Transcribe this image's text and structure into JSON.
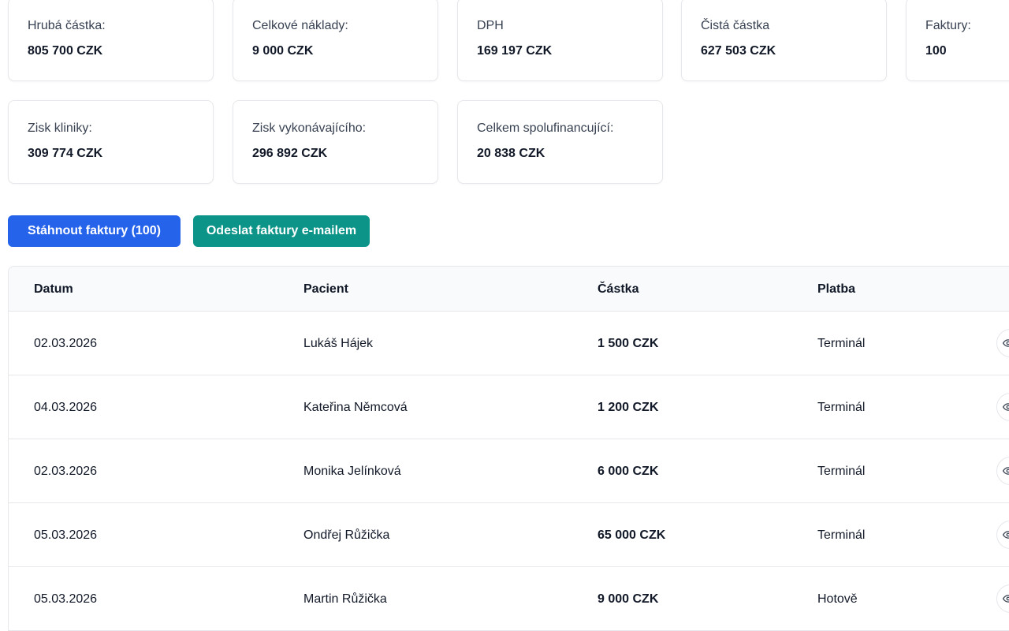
{
  "summary": {
    "row1": [
      {
        "label": "Hrubá částka:",
        "value": "805 700 CZK"
      },
      {
        "label": "Celkové náklady:",
        "value": "9 000 CZK"
      },
      {
        "label": "DPH",
        "value": "169 197 CZK"
      },
      {
        "label": "Čistá částka",
        "value": "627 503 CZK"
      },
      {
        "label": "Faktury:",
        "value": "100"
      }
    ],
    "row2": [
      {
        "label": "Zisk kliniky:",
        "value": "309 774 CZK"
      },
      {
        "label": "Zisk vykonávajícího:",
        "value": "296 892 CZK"
      },
      {
        "label": "Celkem spolufinancující:",
        "value": "20 838 CZK"
      }
    ]
  },
  "actions": {
    "download_label": "Stáhnout faktury (100)",
    "email_label": "Odeslat faktury e-mailem"
  },
  "colors": {
    "primary_button": "#2563eb",
    "secondary_button": "#0d9488"
  },
  "table": {
    "headers": {
      "date": "Datum",
      "patient": "Pacient",
      "amount": "Částka",
      "payment": "Platba"
    },
    "rows": [
      {
        "date": "02.03.2026",
        "patient": "Lukáš Hájek",
        "amount": "1 500 CZK",
        "payment": "Terminál"
      },
      {
        "date": "04.03.2026",
        "patient": "Kateřina Němcová",
        "amount": "1 200 CZK",
        "payment": "Terminál"
      },
      {
        "date": "02.03.2026",
        "patient": "Monika Jelínková",
        "amount": "6 000 CZK",
        "payment": "Terminál"
      },
      {
        "date": "05.03.2026",
        "patient": "Ondřej Růžička",
        "amount": "65 000 CZK",
        "payment": "Terminál"
      },
      {
        "date": "05.03.2026",
        "patient": "Martin Růžička",
        "amount": "9 000 CZK",
        "payment": "Hotově"
      }
    ],
    "row_action_icon": "eye-icon"
  }
}
